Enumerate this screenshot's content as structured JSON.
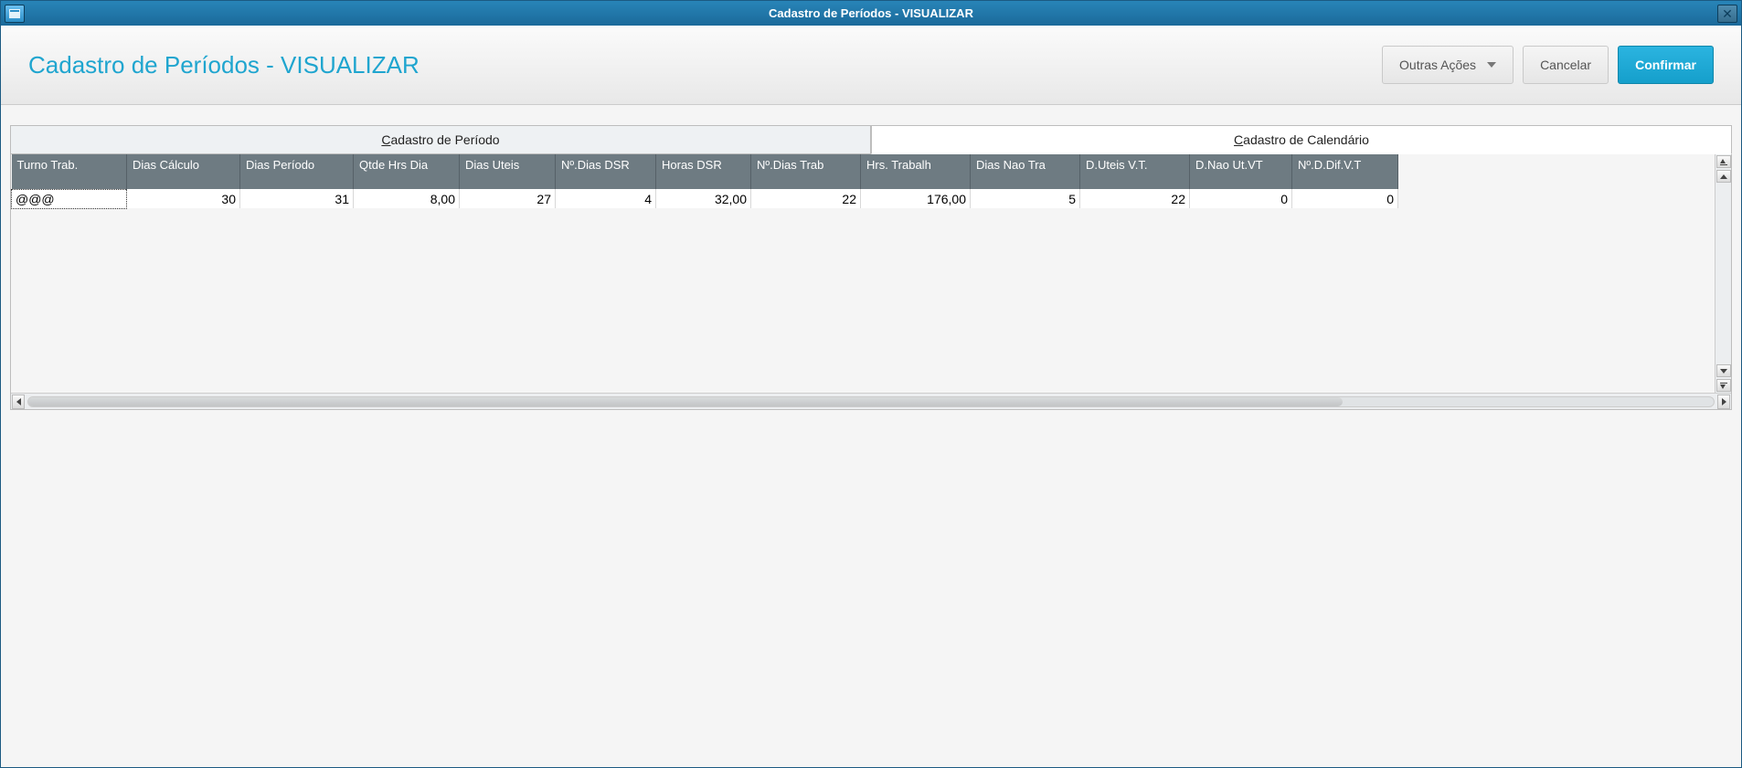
{
  "window": {
    "title": "Cadastro de Períodos - VISUALIZAR"
  },
  "page": {
    "title": "Cadastro de Períodos - VISUALIZAR"
  },
  "actions": {
    "other": "Outras Ações",
    "cancel": "Cancelar",
    "confirm": "Confirmar"
  },
  "tabs": {
    "cadastro_periodo_prefix": "C",
    "cadastro_periodo_rest": "adastro de Período",
    "cadastro_calendario_prefix": "C",
    "cadastro_calendario_rest": "adastro de Calendário"
  },
  "grid": {
    "headers": {
      "turno_trab": "Turno Trab.",
      "dias_calculo": "Dias Cálculo",
      "dias_periodo": "Dias Período",
      "qtde_hrs_dia": "Qtde Hrs Dia",
      "dias_uteis": "Dias Uteis",
      "n_dias_dsr": "Nº.Dias DSR",
      "horas_dsr": "Horas DSR",
      "n_dias_trab": "Nº.Dias Trab",
      "hrs_trabalh": "Hrs. Trabalh",
      "dias_nao_tra": "Dias Nao Tra",
      "d_uteis_vt": "D.Uteis V.T.",
      "d_nao_ut_vt": "D.Nao Ut.VT",
      "n_d_dif_vt": "Nº.D.Dif.V.T"
    },
    "rows": [
      {
        "turno_trab": "@@@",
        "dias_calculo": "30",
        "dias_periodo": "31",
        "qtde_hrs_dia": "8,00",
        "dias_uteis": "27",
        "n_dias_dsr": "4",
        "horas_dsr": "32,00",
        "n_dias_trab": "22",
        "hrs_trabalh": "176,00",
        "dias_nao_tra": "5",
        "d_uteis_vt": "22",
        "d_nao_ut_vt": "0",
        "n_d_dif_vt": "0"
      }
    ]
  }
}
